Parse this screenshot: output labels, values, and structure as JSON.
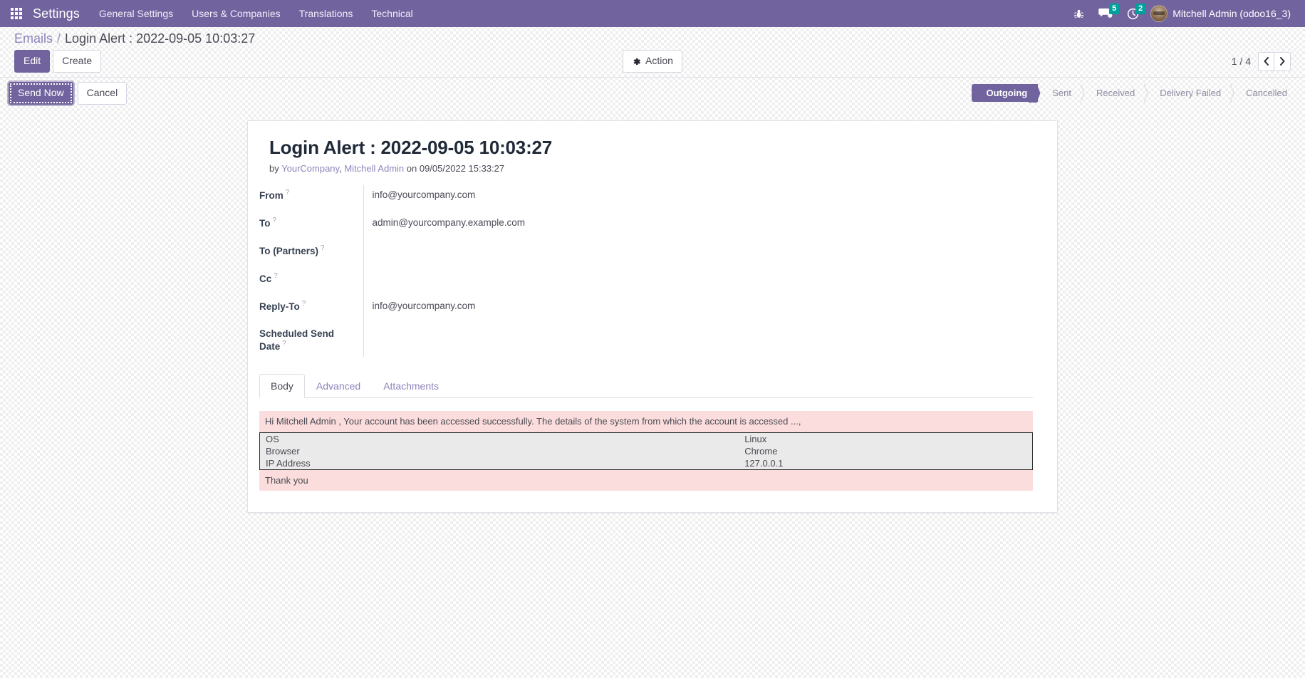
{
  "navbar": {
    "brand": "Settings",
    "apps_icon": "grid-apps-icon",
    "menu": [
      {
        "label": "General Settings"
      },
      {
        "label": "Users & Companies"
      },
      {
        "label": "Translations"
      },
      {
        "label": "Technical"
      }
    ],
    "bug_icon": "bug-icon",
    "messages_icon": "messages-icon",
    "messages_count": "5",
    "activities_icon": "clock-activities-icon",
    "activities_count": "2",
    "user_name": "Mitchell Admin (odoo16_3)",
    "accent_color": "#71639e",
    "badge_color": "#00a09d"
  },
  "breadcrumb": {
    "parent": "Emails",
    "separator": "/",
    "current": "Login Alert : 2022-09-05 10:03:27"
  },
  "control_panel": {
    "edit_label": "Edit",
    "create_label": "Create",
    "action_label": "Action",
    "action_icon": "gear-icon",
    "pager_value": "1 / 4",
    "pager_prev_icon": "chevron-left-icon",
    "pager_next_icon": "chevron-right-icon"
  },
  "statusbar_row": {
    "send_now_label": "Send Now",
    "cancel_label": "Cancel",
    "stages": [
      {
        "label": "Outgoing",
        "active": true
      },
      {
        "label": "Sent",
        "active": false
      },
      {
        "label": "Received",
        "active": false
      },
      {
        "label": "Delivery Failed",
        "active": false
      },
      {
        "label": "Cancelled",
        "active": false
      }
    ]
  },
  "record": {
    "title": "Login Alert : 2022-09-05 10:03:27",
    "subtitle_prefix": "by",
    "author_company": "YourCompany",
    "subtitle_comma": ",",
    "author_user": "Mitchell Admin",
    "subtitle_on": "on",
    "subtitle_date": "09/05/2022 15:33:27",
    "fields": [
      {
        "label": "From",
        "help": "?",
        "value": "info@yourcompany.com"
      },
      {
        "label": "To",
        "help": "?",
        "value": "admin@yourcompany.example.com"
      },
      {
        "label": "To (Partners)",
        "help": "?",
        "value": ""
      },
      {
        "label": "Cc",
        "help": "?",
        "value": ""
      },
      {
        "label": "Reply-To",
        "help": "?",
        "value": "info@yourcompany.com"
      },
      {
        "label": "Scheduled Send Date",
        "help": "?",
        "value": ""
      }
    ]
  },
  "notebook": {
    "tabs": [
      {
        "label": "Body",
        "active": true
      },
      {
        "label": "Advanced",
        "active": false
      },
      {
        "label": "Attachments",
        "active": false
      }
    ]
  },
  "mail_body": {
    "greeting": "Hi Mitchell Admin , Your account has been accessed successfully. The details of the system from which the account is accessed ...,",
    "details": [
      {
        "key": "OS",
        "value": "Linux"
      },
      {
        "key": "Browser",
        "value": "Chrome"
      },
      {
        "key": "IP Address",
        "value": "127.0.0.1"
      }
    ],
    "closing": "Thank you",
    "background_color": "#fbdddd",
    "table_background_color": "#eaeaea"
  }
}
